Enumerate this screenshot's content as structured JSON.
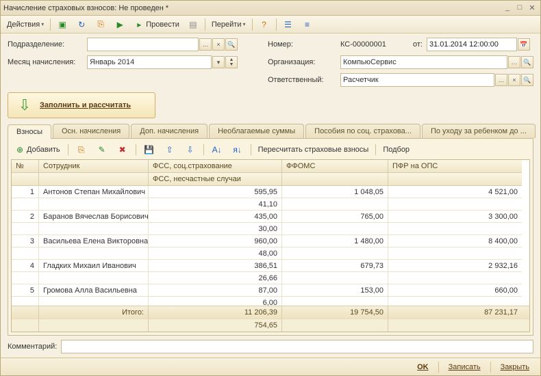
{
  "window": {
    "title": "Начисление страховых взносов: Не проведен *"
  },
  "toolbar": {
    "actions": "Действия",
    "post": "Провести",
    "goto": "Перейти"
  },
  "form": {
    "dept_label": "Подразделение:",
    "dept_value": "",
    "month_label": "Месяц начисления:",
    "month_value": "Январь 2014",
    "number_label": "Номер:",
    "number_value": "КС-00000001",
    "from_label": "от:",
    "date_value": "31.01.2014 12:00:00",
    "org_label": "Организация:",
    "org_value": "КомпьюСервис",
    "resp_label": "Ответственный:",
    "resp_value": "Расчетчик",
    "bigbutton": "Заполнить и рассчитать"
  },
  "tabs": [
    "Взносы",
    "Осн. начисления",
    "Доп. начисления",
    "Необлагаемые суммы",
    "Пособия по соц. страхова...",
    "По уходу за ребенком до ..."
  ],
  "grid_toolbar": {
    "add": "Добавить",
    "recalc": "Пересчитать страховые взносы",
    "select": "Подбор"
  },
  "grid": {
    "cols": {
      "n": "№",
      "emp": "Сотрудник",
      "fss1": "ФСС, соц.страхование",
      "fss2": "ФСС, несчастные случаи",
      "ffoms": "ФФОМС",
      "pfr": "ПФР на ОПС"
    },
    "rows": [
      {
        "n": "1",
        "emp": "Антонов Степан Михайлович",
        "fss1": "595,95",
        "fss2": "41,10",
        "ffoms": "1 048,05",
        "pfr": "4 521,00"
      },
      {
        "n": "2",
        "emp": "Баранов Вячеслав Борисович",
        "fss1": "435,00",
        "fss2": "30,00",
        "ffoms": "765,00",
        "pfr": "3 300,00"
      },
      {
        "n": "3",
        "emp": "Васильева Елена Викторовна",
        "fss1": "960,00",
        "fss2": "48,00",
        "ffoms": "1 480,00",
        "pfr": "8 400,00"
      },
      {
        "n": "4",
        "emp": "Гладких Михаил Иванович",
        "fss1": "386,51",
        "fss2": "26,66",
        "ffoms": "679,73",
        "pfr": "2 932,16"
      },
      {
        "n": "5",
        "emp": "Громова Алла Васильевна",
        "fss1": "87,00",
        "fss2": "6,00",
        "ffoms": "153,00",
        "pfr": "660,00"
      }
    ],
    "totals": {
      "label": "Итого:",
      "fss1": "11 206,39",
      "fss2": "754,65",
      "ffoms": "19 754,50",
      "pfr": "87 231,17"
    }
  },
  "comment": {
    "label": "Комментарий:",
    "value": ""
  },
  "footer": {
    "ok": "OK",
    "save": "Записать",
    "close": "Закрыть"
  }
}
